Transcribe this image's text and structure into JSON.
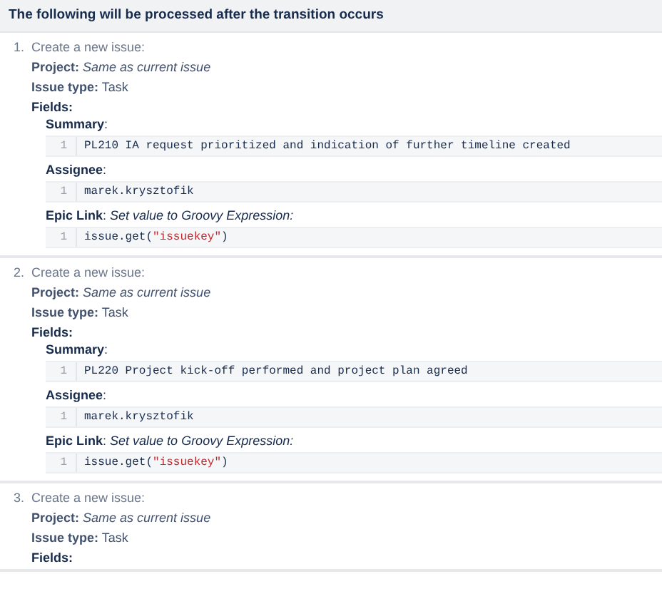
{
  "header": "The following will be processed after the transition occurs",
  "actions": [
    {
      "number": "1.",
      "title": "Create a new issue:",
      "lines": [
        "**Project:** *Same as current issue*",
        "**Issue type:** Task"
      ],
      "fields_label": "Fields:",
      "fields": [
        {
          "label": "**Summary**:",
          "code": [
            {
              "line_number": "1",
              "tokens": [
                {
                  "kind": "plain",
                  "text": "PL210 IA request prioritized and indication of further timeline created"
                }
              ]
            }
          ]
        },
        {
          "label": "**Assignee**:",
          "code": [
            {
              "line_number": "1",
              "tokens": [
                {
                  "kind": "plain",
                  "text": "marek.krysztofik"
                }
              ]
            }
          ]
        },
        {
          "label": "**Epic Link**: *Set value to Groovy Expression:*",
          "code": [
            {
              "line_number": "1",
              "tokens": [
                {
                  "kind": "plain",
                  "text": "issue.get("
                },
                {
                  "kind": "string",
                  "text": "\"issuekey\""
                },
                {
                  "kind": "plain",
                  "text": ")"
                }
              ]
            }
          ]
        }
      ]
    },
    {
      "number": "2.",
      "title": "Create a new issue:",
      "lines": [
        "**Project:** *Same as current issue*",
        "**Issue type:** Task"
      ],
      "fields_label": "Fields:",
      "fields": [
        {
          "label": "**Summary**:",
          "code": [
            {
              "line_number": "1",
              "tokens": [
                {
                  "kind": "plain",
                  "text": "PL220 Project kick-off performed and project plan agreed"
                }
              ]
            }
          ]
        },
        {
          "label": "**Assignee**:",
          "code": [
            {
              "line_number": "1",
              "tokens": [
                {
                  "kind": "plain",
                  "text": "marek.krysztofik"
                }
              ]
            }
          ]
        },
        {
          "label": "**Epic Link**: *Set value to Groovy Expression:*",
          "code": [
            {
              "line_number": "1",
              "tokens": [
                {
                  "kind": "plain",
                  "text": "issue.get("
                },
                {
                  "kind": "string",
                  "text": "\"issuekey\""
                },
                {
                  "kind": "plain",
                  "text": ")"
                }
              ]
            }
          ]
        }
      ]
    },
    {
      "number": "3.",
      "title": "Create a new issue:",
      "lines": [
        "**Project:** *Same as current issue*",
        "**Issue type:** Task"
      ],
      "fields_label": "Fields:"
    }
  ]
}
